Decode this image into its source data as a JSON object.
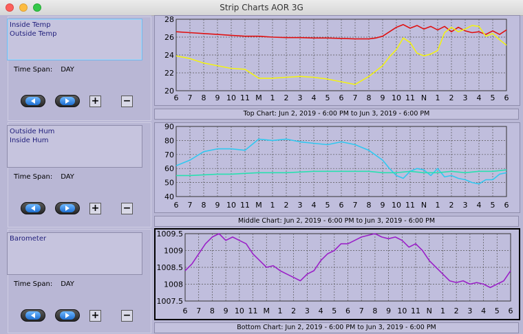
{
  "window": {
    "title": "Strip Charts   AOR 3G"
  },
  "panels": [
    {
      "items": [
        "Inside Temp",
        "Outside Temp"
      ],
      "time_span_label": "Time Span:",
      "time_span_value": "DAY",
      "selected": true
    },
    {
      "items": [
        "Outside Hum",
        "Inside Hum"
      ],
      "time_span_label": "Time Span:",
      "time_span_value": "DAY",
      "selected": false
    },
    {
      "items": [
        "Barometer"
      ],
      "time_span_label": "Time Span:",
      "time_span_value": "DAY",
      "selected": false
    }
  ],
  "buttons": {
    "back_icon": "left-arrow-icon",
    "forward_icon": "right-arrow-icon",
    "plus_label": "+",
    "minus_label": "−"
  },
  "captions": {
    "top": "Top Chart:  Jun 2, 2019 - 6:00 PM  to  Jun 3, 2019 - 6:00 PM",
    "middle": "Middle Chart:  Jun 2, 2019 - 6:00 PM  to  Jun 3, 2019 - 6:00 PM",
    "bottom": "Bottom Chart:  Jun 2, 2019 - 6:00 PM  to  Jun 3, 2019 - 6:00 PM"
  },
  "colors": {
    "plot_bg": "#c0bedd",
    "inside_temp": "#e01010",
    "outside_temp": "#f2f214",
    "outside_hum": "#30c8f0",
    "inside_hum": "#28e0b0",
    "barometer": "#9a20c8"
  },
  "chart_data": [
    {
      "type": "line",
      "x_tick_labels": [
        "6",
        "7",
        "8",
        "9",
        "10",
        "11",
        "M",
        "1",
        "2",
        "3",
        "4",
        "5",
        "6",
        "7",
        "8",
        "9",
        "10",
        "11",
        "N",
        "1",
        "2",
        "3",
        "4",
        "5",
        "6"
      ],
      "ylim": [
        20,
        28
      ],
      "y_ticks": [
        "20",
        "22",
        "24",
        "26",
        "28"
      ],
      "grid": true,
      "series": [
        {
          "name": "Inside Temp",
          "color": "#e01010",
          "x": [
            0,
            1,
            2,
            3,
            4,
            5,
            6,
            7,
            8,
            9,
            10,
            11,
            12,
            13,
            14,
            14.5,
            15,
            15.5,
            16,
            16.5,
            17,
            17.5,
            18,
            18.5,
            19,
            19.5,
            20,
            20.5,
            21,
            21.5,
            22,
            22.5,
            23,
            23.5,
            24
          ],
          "y": [
            26.6,
            26.5,
            26.4,
            26.3,
            26.2,
            26.1,
            26.1,
            26.0,
            25.95,
            25.95,
            25.9,
            25.9,
            25.85,
            25.8,
            25.8,
            25.9,
            26.1,
            26.6,
            27.1,
            27.4,
            27.0,
            27.3,
            26.9,
            27.2,
            26.8,
            27.2,
            26.6,
            27.1,
            26.7,
            26.5,
            26.6,
            26.3,
            26.7,
            26.3,
            26.8
          ]
        },
        {
          "name": "Outside Temp",
          "color": "#f2f214",
          "x": [
            0,
            1,
            2,
            3,
            4,
            5,
            6,
            7,
            8,
            9,
            10,
            11,
            12,
            13,
            14,
            15,
            15.5,
            16,
            16.5,
            17,
            17.5,
            18,
            18.5,
            19,
            19.5,
            20,
            20.5,
            21,
            21.5,
            22,
            22.5,
            23,
            23.5,
            24
          ],
          "y": [
            23.9,
            23.6,
            23.1,
            22.8,
            22.5,
            22.4,
            21.4,
            21.4,
            21.5,
            21.6,
            21.5,
            21.3,
            21.0,
            20.7,
            21.6,
            22.8,
            23.8,
            24.6,
            25.9,
            25.4,
            24.2,
            23.9,
            24.1,
            24.5,
            26.5,
            27.1,
            26.6,
            26.9,
            27.3,
            27.2,
            26.1,
            26.4,
            25.7,
            25.1
          ]
        }
      ]
    },
    {
      "type": "line",
      "x_tick_labels": [
        "6",
        "7",
        "8",
        "9",
        "10",
        "11",
        "M",
        "1",
        "2",
        "3",
        "4",
        "5",
        "6",
        "7",
        "8",
        "9",
        "10",
        "11",
        "N",
        "1",
        "2",
        "3",
        "4",
        "5",
        "6"
      ],
      "ylim": [
        40,
        90
      ],
      "y_ticks": [
        "40",
        "50",
        "60",
        "70",
        "80",
        "90"
      ],
      "grid": true,
      "series": [
        {
          "name": "Outside Hum",
          "color": "#30c8f0",
          "x": [
            0,
            1,
            2,
            3,
            4,
            5,
            6,
            7,
            8,
            9,
            10,
            11,
            12,
            13,
            14,
            15,
            15.5,
            16,
            16.5,
            17,
            17.5,
            18,
            18.5,
            19,
            19.5,
            20,
            20.5,
            21,
            21.5,
            22,
            22.5,
            23,
            23.5,
            24
          ],
          "y": [
            62,
            66,
            72,
            74,
            74,
            73,
            81,
            80,
            81,
            79,
            78,
            77,
            79,
            77,
            73,
            66,
            60,
            55,
            53,
            58,
            60,
            59,
            55,
            60,
            54,
            55,
            53,
            52,
            50,
            49,
            52,
            52,
            56,
            57
          ]
        },
        {
          "name": "Inside Hum",
          "color": "#28e0b0",
          "x": [
            0,
            1,
            2,
            3,
            4,
            5,
            6,
            7,
            8,
            9,
            10,
            11,
            12,
            13,
            14,
            15,
            16,
            17,
            18,
            19,
            20,
            21,
            22,
            23,
            24
          ],
          "y": [
            55,
            55,
            55.5,
            56,
            56,
            56.5,
            57,
            57,
            57,
            57.5,
            58,
            58,
            58,
            58,
            58,
            57,
            57,
            58,
            57,
            57,
            58,
            57,
            58,
            58,
            59
          ]
        }
      ]
    },
    {
      "type": "line",
      "x_tick_labels": [
        "6",
        "7",
        "8",
        "9",
        "10",
        "11",
        "M",
        "1",
        "2",
        "3",
        "4",
        "5",
        "6",
        "7",
        "8",
        "9",
        "10",
        "11",
        "N",
        "1",
        "2",
        "3",
        "4",
        "5",
        "6"
      ],
      "ylim": [
        1007.5,
        1009.5
      ],
      "y_ticks": [
        "1007.5",
        "1008",
        "1008.5",
        "1009",
        "1009.5"
      ],
      "grid": true,
      "series": [
        {
          "name": "Barometer",
          "color": "#9a20c8",
          "x": [
            0,
            0.5,
            1,
            1.5,
            2,
            2.5,
            3,
            3.5,
            4,
            4.5,
            5,
            5.5,
            6,
            6.5,
            7,
            7.5,
            8,
            8.5,
            9,
            9.5,
            10,
            10.5,
            11,
            11.5,
            12,
            12.5,
            13,
            13.5,
            14,
            14.5,
            15,
            15.5,
            16,
            16.5,
            17,
            17.5,
            18,
            18.5,
            19,
            19.5,
            20,
            20.5,
            21,
            21.5,
            22,
            22.5,
            23,
            23.5,
            24
          ],
          "y": [
            1008.4,
            1008.6,
            1008.9,
            1009.2,
            1009.4,
            1009.5,
            1009.3,
            1009.4,
            1009.3,
            1009.2,
            1008.9,
            1008.7,
            1008.5,
            1008.55,
            1008.4,
            1008.3,
            1008.2,
            1008.1,
            1008.3,
            1008.4,
            1008.7,
            1008.9,
            1009.0,
            1009.2,
            1009.2,
            1009.3,
            1009.4,
            1009.45,
            1009.5,
            1009.4,
            1009.35,
            1009.4,
            1009.3,
            1009.1,
            1009.2,
            1009.0,
            1008.7,
            1008.5,
            1008.3,
            1008.1,
            1008.05,
            1008.1,
            1008.0,
            1008.05,
            1008.0,
            1007.9,
            1008.0,
            1008.1,
            1008.4
          ]
        }
      ]
    }
  ]
}
